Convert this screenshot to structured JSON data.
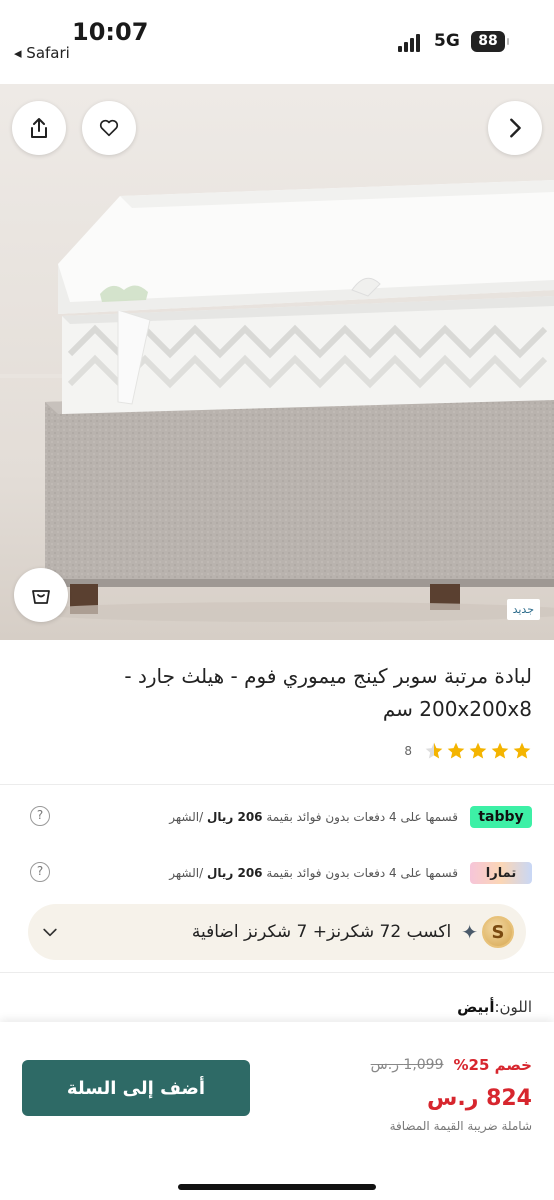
{
  "status_bar": {
    "time": "10:07",
    "back_app": "◂ Safari",
    "network": "5G",
    "battery": "88"
  },
  "hero": {
    "new_badge": "جديد",
    "icons": [
      "share-icon",
      "heart-icon",
      "chevron-right-icon",
      "cart-icon"
    ]
  },
  "product": {
    "title": "لبادة مرتبة سوبر كينج ميموري فوم - هيلث جارد - 200x200x8 سم",
    "rating": 4.5,
    "review_count": "8"
  },
  "payments": {
    "tabby_logo": "tabby",
    "tamara_logo": "تمارا",
    "installment_prefix": "قسمها على 4 دفعات بدون فوائد بقيمة",
    "installment_amount": "206 ريال",
    "installment_suffix": "/الشهر",
    "help": "?"
  },
  "points": {
    "coin_letter": "S",
    "spark": "✦",
    "text": "اكسب 72 شكرنز+  7 شكرنز اضافية"
  },
  "color": {
    "label": "اللون:",
    "value": "أبيض"
  },
  "purchase": {
    "add_to_cart": "أضف إلى السلة",
    "discount": "خصم 25%",
    "old_price": "1,099 ر.س",
    "new_price": "824 ر.س",
    "vat_note": "شاملة ضريبة القيمة المضافة"
  },
  "colors": {
    "primary": "#2e6a66",
    "sale": "#d7262e",
    "star": "#f4b400"
  }
}
